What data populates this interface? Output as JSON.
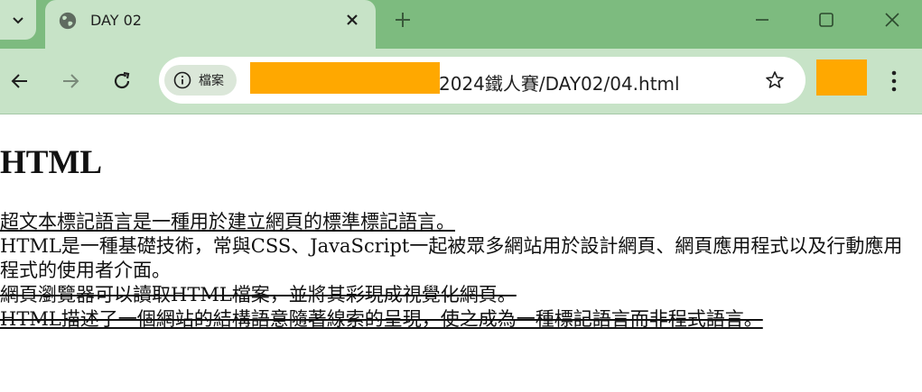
{
  "browser": {
    "tab": {
      "title": "DAY 02",
      "favicon": "globe-icon"
    },
    "address_bar": {
      "site_chip_label": "檔案",
      "url_visible": "2024鐵人賽/DAY02/04.html"
    },
    "colors": {
      "tabbar_bg": "#7dbb7f",
      "toolbar_bg": "#c7e3c7",
      "redaction": "#ffa800"
    }
  },
  "page": {
    "heading": "HTML",
    "lines": [
      {
        "text": "超文本標記語言是一種用於建立網頁的標準標記語言。",
        "style": "underline"
      },
      {
        "text": "HTML是一種基礎技術，常與CSS、JavaScript一起被眾多網站用於設計網頁、網頁應用程式以及行動應用程式的使用者介面。",
        "style": "normal"
      },
      {
        "text": "網頁瀏覽器可以讀取HTML檔案，並將其彩現成視覺化網頁。",
        "style": "line-through"
      },
      {
        "text": "HTML描述了一個網站的結構語意隨著線索的呈現，使之成為一種標記語言而非程式語言。",
        "style": "underline line-through"
      }
    ]
  }
}
